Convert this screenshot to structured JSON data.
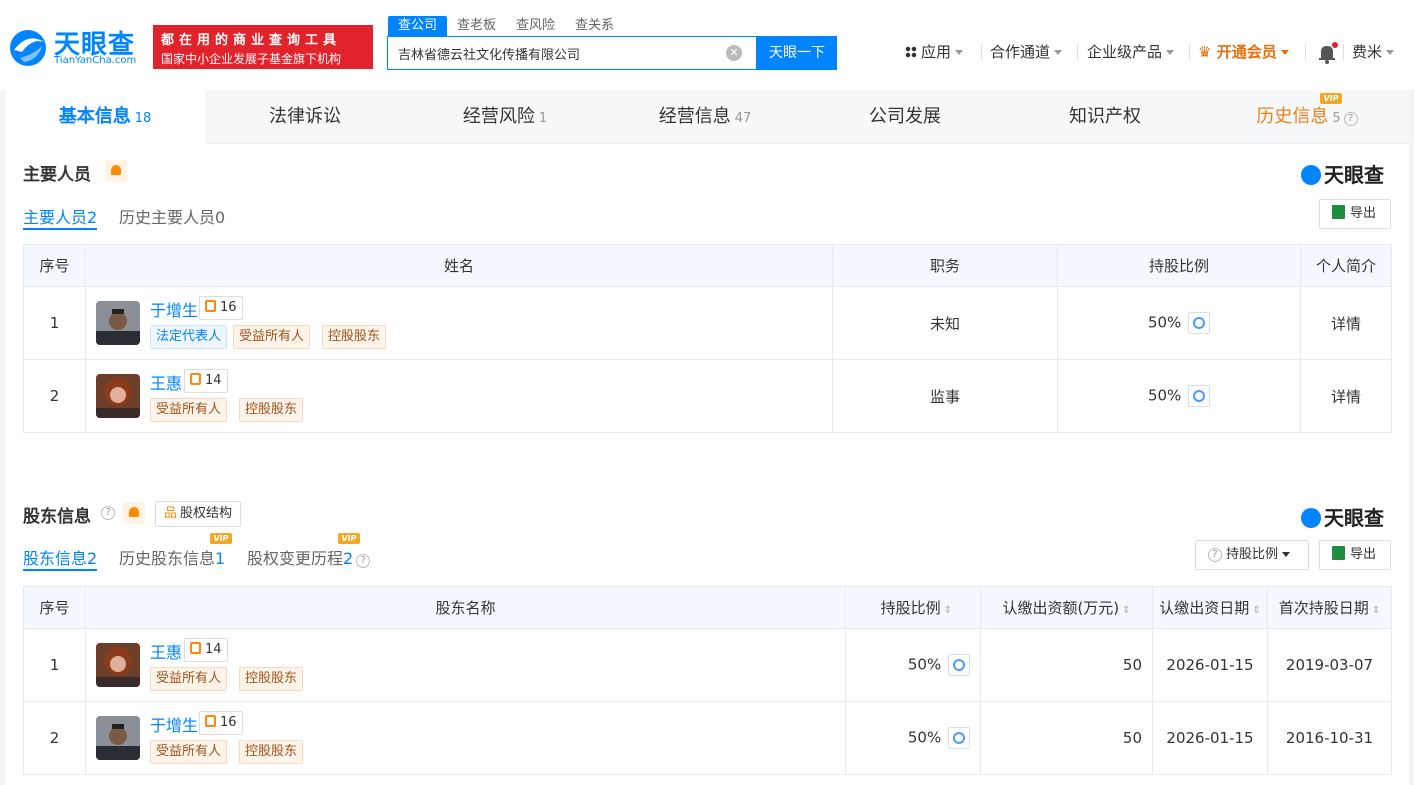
{
  "brand": {
    "name": "天眼查",
    "domain": "TianYanCha.com",
    "slogan_line1": "都在用的商业查询工具",
    "slogan_line2": "国家中小企业发展子基金旗下机构"
  },
  "search": {
    "tabs": [
      "查公司",
      "查老板",
      "查风险",
      "查关系"
    ],
    "value": "吉林省德云社文化传播有限公司",
    "button": "天眼一下"
  },
  "nav": {
    "apps": "应用",
    "partner": "合作通道",
    "enterprise": "企业级产品",
    "vip": "开通会员",
    "user": "费米"
  },
  "tabs": [
    {
      "label": "基本信息",
      "count": "18"
    },
    {
      "label": "法律诉讼",
      "count": ""
    },
    {
      "label": "经营风险",
      "count": "1"
    },
    {
      "label": "经营信息",
      "count": "47"
    },
    {
      "label": "公司发展",
      "count": ""
    },
    {
      "label": "知识产权",
      "count": ""
    },
    {
      "label": "历史信息",
      "count": "5"
    }
  ],
  "personnel": {
    "title": "主要人员",
    "logo": "天眼查",
    "subtabs": [
      {
        "label": "主要人员",
        "count": "2"
      },
      {
        "label": "历史主要人员",
        "count": "0"
      }
    ],
    "export": "导出",
    "headers": [
      "序号",
      "姓名",
      "职务",
      "持股比例",
      "个人简介"
    ],
    "rows": [
      {
        "no": "1",
        "name": "于增生",
        "rel": "16",
        "tags": [
          "法定代表人",
          "受益所有人",
          "控股股东"
        ],
        "role": "未知",
        "share": "50%",
        "detail": "详情"
      },
      {
        "no": "2",
        "name": "王惠",
        "rel": "14",
        "tags": [
          "受益所有人",
          "控股股东"
        ],
        "role": "监事",
        "share": "50%",
        "detail": "详情"
      }
    ]
  },
  "shareholders": {
    "title": "股东信息",
    "structure_btn": "股权结构",
    "logo": "天眼查",
    "subtabs": [
      {
        "label": "股东信息",
        "count": "2"
      },
      {
        "label": "历史股东信息",
        "count": "1"
      },
      {
        "label": "股权变更历程",
        "count": "2"
      }
    ],
    "vip_label": "VIP",
    "ratio_filter": "持股比例",
    "export": "导出",
    "headers": [
      "序号",
      "股东名称",
      "持股比例",
      "认缴出资额(万元)",
      "认缴出资日期",
      "首次持股日期"
    ],
    "rows": [
      {
        "no": "1",
        "name": "王惠",
        "rel": "14",
        "tags": [
          "受益所有人",
          "控股股东"
        ],
        "share": "50%",
        "amount": "50",
        "date": "2026-01-15",
        "first": "2019-03-07"
      },
      {
        "no": "2",
        "name": "于增生",
        "rel": "16",
        "tags": [
          "受益所有人",
          "控股股东"
        ],
        "share": "50%",
        "amount": "50",
        "date": "2026-01-15",
        "first": "2016-10-31"
      }
    ]
  }
}
